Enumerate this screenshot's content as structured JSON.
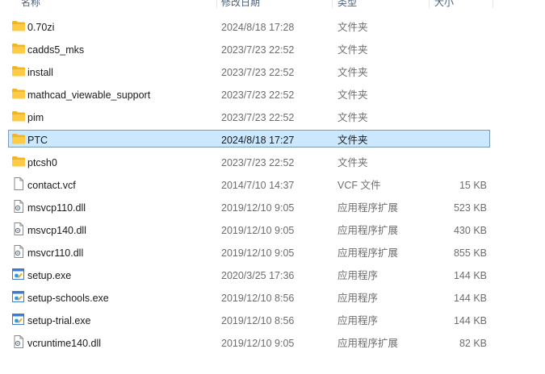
{
  "columns": {
    "name": "名称",
    "date": "修改日期",
    "type": "类型",
    "size": "大小"
  },
  "rows": [
    {
      "name": "0.70zi",
      "date": "2024/8/18 17:28",
      "type": "文件夹",
      "size": "",
      "icon": "folder-icon"
    },
    {
      "name": "cadds5_mks",
      "date": "2023/7/23 22:52",
      "type": "文件夹",
      "size": "",
      "icon": "folder-icon"
    },
    {
      "name": "install",
      "date": "2023/7/23 22:52",
      "type": "文件夹",
      "size": "",
      "icon": "folder-icon"
    },
    {
      "name": "mathcad_viewable_support",
      "date": "2023/7/23 22:52",
      "type": "文件夹",
      "size": "",
      "icon": "folder-icon"
    },
    {
      "name": "pim",
      "date": "2023/7/23 22:52",
      "type": "文件夹",
      "size": "",
      "icon": "folder-icon"
    },
    {
      "name": "PTC",
      "date": "2024/8/18 17:27",
      "type": "文件夹",
      "size": "",
      "icon": "folder-icon",
      "selected": true
    },
    {
      "name": "ptcsh0",
      "date": "2023/7/23 22:52",
      "type": "文件夹",
      "size": "",
      "icon": "folder-icon"
    },
    {
      "name": "contact.vcf",
      "date": "2014/7/10 14:37",
      "type": "VCF 文件",
      "size": "15 KB",
      "icon": "file-icon"
    },
    {
      "name": "msvcp110.dll",
      "date": "2019/12/10 9:05",
      "type": "应用程序扩展",
      "size": "523 KB",
      "icon": "dll-file-icon"
    },
    {
      "name": "msvcp140.dll",
      "date": "2019/12/10 9:05",
      "type": "应用程序扩展",
      "size": "430 KB",
      "icon": "dll-file-icon"
    },
    {
      "name": "msvcr110.dll",
      "date": "2019/12/10 9:05",
      "type": "应用程序扩展",
      "size": "855 KB",
      "icon": "dll-file-icon"
    },
    {
      "name": "setup.exe",
      "date": "2020/3/25 17:36",
      "type": "应用程序",
      "size": "144 KB",
      "icon": "exe-icon"
    },
    {
      "name": "setup-schools.exe",
      "date": "2019/12/10 8:56",
      "type": "应用程序",
      "size": "144 KB",
      "icon": "exe-icon"
    },
    {
      "name": "setup-trial.exe",
      "date": "2019/12/10 8:56",
      "type": "应用程序",
      "size": "144 KB",
      "icon": "exe-icon"
    },
    {
      "name": "vcruntime140.dll",
      "date": "2019/12/10 9:05",
      "type": "应用程序扩展",
      "size": "82 KB",
      "icon": "dll-file-icon"
    }
  ]
}
